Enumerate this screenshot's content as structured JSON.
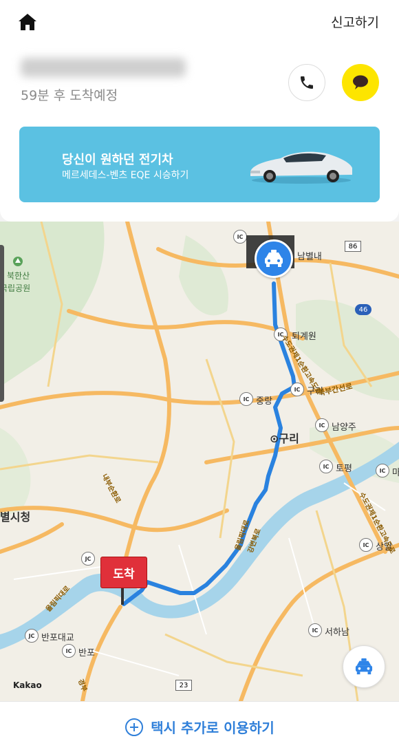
{
  "header": {
    "report_label": "신고하기",
    "eta": "59분 후 도착예정"
  },
  "banner": {
    "title": "당신이 원하던 전기차",
    "subtitle": "메르세데스-벤츠 EQE 시승하기",
    "color": "#5bc1e2"
  },
  "map": {
    "labels": {
      "bukhansan": "북한산",
      "bukhansan2": "국립공원",
      "namyangju_city": "별시청",
      "guri": "구리",
      "nambyeolnae": "남별내",
      "toegyewon": "퇴계원",
      "jungnang": "중랑",
      "guri_ic": "구리",
      "namyangju": "남양주",
      "topyeong": "토평",
      "sangil": "상일",
      "seohanam": "서하남",
      "banpo_bridge": "반포대교",
      "banpo": "반포",
      "ma": "마"
    },
    "road_labels": {
      "bukbu": "북부간선로",
      "sudogwon1": "수도권제1순환고속도로",
      "sudogwon2": "수도권제1순환고속도로",
      "olympic": "올림픽대로",
      "gangbyeon": "강변북로",
      "naebu": "내부순환로",
      "gyeongbu": "경부"
    },
    "route_shields": {
      "r86": "86",
      "r46": "46",
      "r23": "23"
    },
    "destination_label": "도착",
    "kakao_logo": "Kakao",
    "route_color": "#2a82df"
  },
  "bottom": {
    "add_taxi_label": "택시 추가로 이용하기"
  },
  "icons": {
    "home": "home-icon",
    "phone": "phone-icon",
    "chat": "chat-bubble-icon",
    "taxi": "taxi-icon",
    "plus": "plus-circle-icon"
  }
}
